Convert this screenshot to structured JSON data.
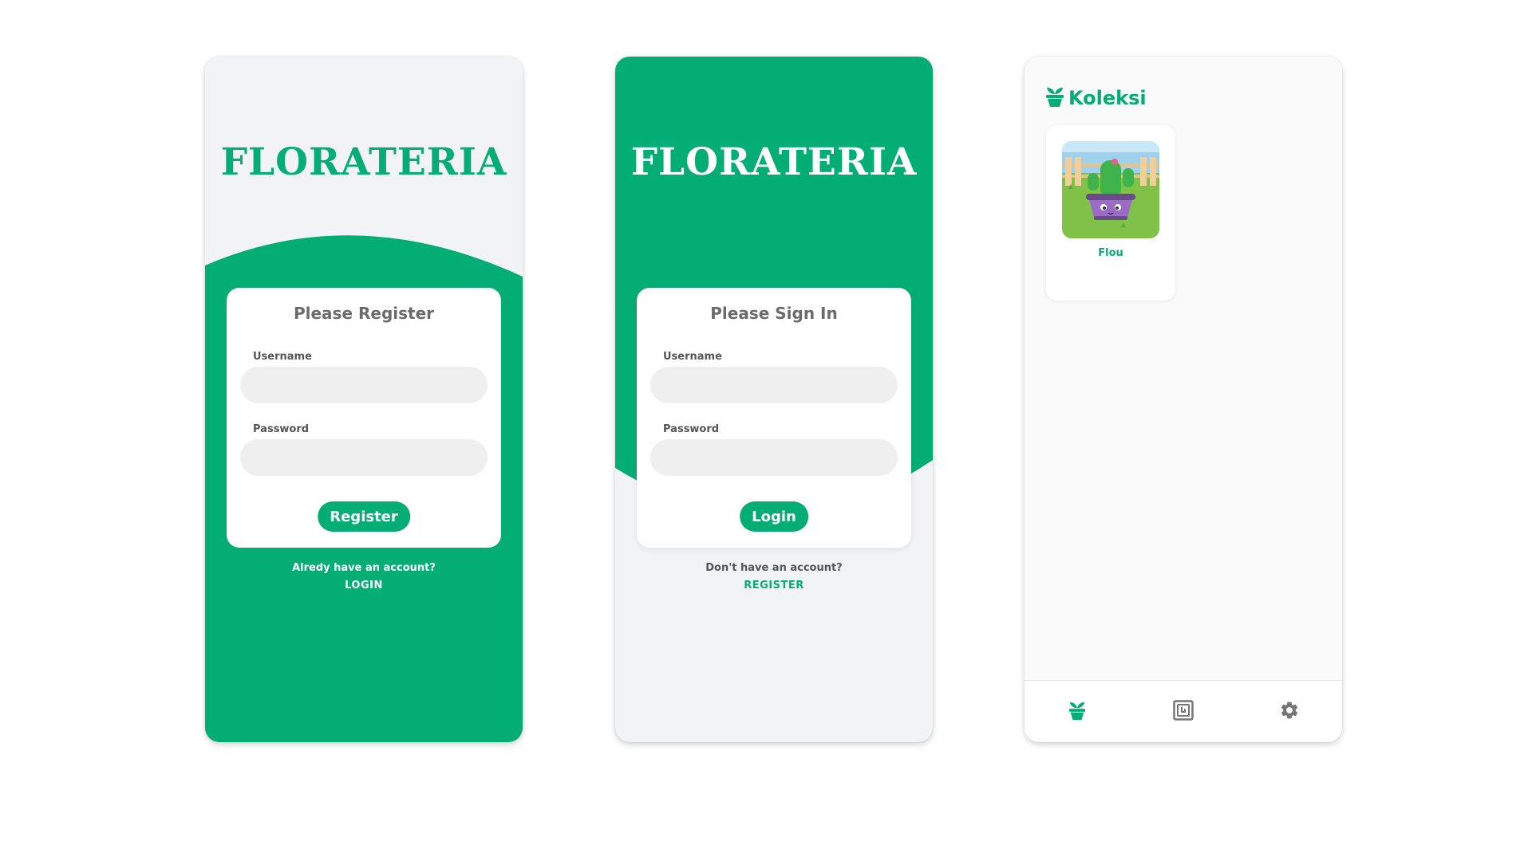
{
  "colors": {
    "primary": "#04ad73",
    "light_bg": "#f2f3f5",
    "input_bg": "#efefef",
    "muted_text": "#6b6b6b",
    "nav_icon": "#757575"
  },
  "register_screen": {
    "brand": "FLORATERIA",
    "card_title": "Please Register",
    "username_label": "Username",
    "password_label": "Password",
    "username_value": "",
    "password_value": "",
    "button_label": "Register",
    "prompt": "Alredy have an account?",
    "switch_link": "LOGIN"
  },
  "login_screen": {
    "brand": "FLORATERIA",
    "card_title": "Please Sign In",
    "username_label": "Username",
    "password_label": "Password",
    "username_value": "",
    "password_value": "",
    "button_label": "Login",
    "prompt": "Don't have an account?",
    "switch_link": "REGISTER"
  },
  "collection_screen": {
    "header_icon": "plant-pot-icon",
    "title": "Koleksi",
    "plants": [
      {
        "name": "Flou",
        "image": "cactus-pot-illustration"
      }
    ],
    "bottom_nav": [
      {
        "icon": "plant-pot-icon",
        "active": true
      },
      {
        "icon": "scan-icon",
        "active": false
      },
      {
        "icon": "gear-icon",
        "active": false
      }
    ]
  }
}
